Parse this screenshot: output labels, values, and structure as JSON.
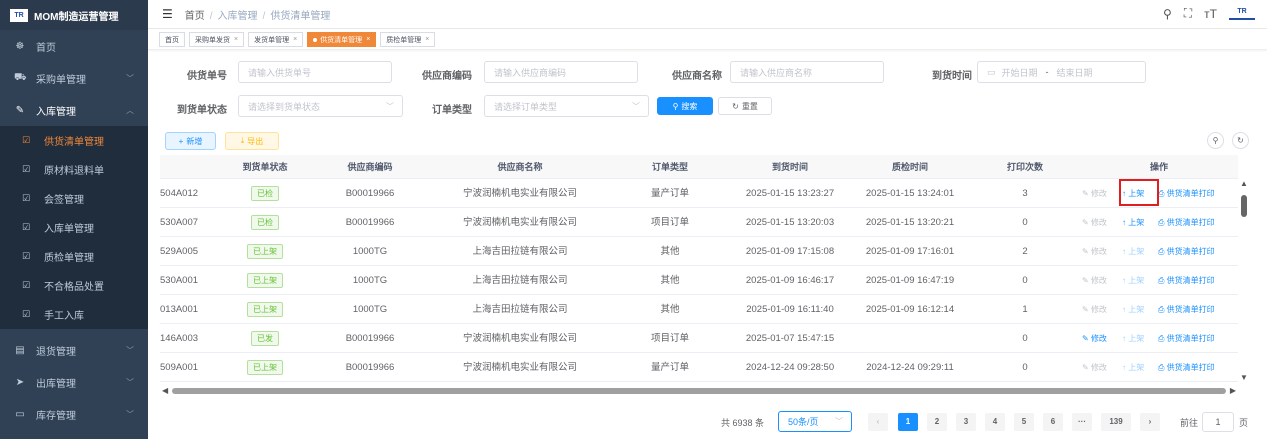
{
  "app": {
    "logo_text": "TR",
    "title": "MOM制造运营管理"
  },
  "sidebar": {
    "items": [
      {
        "label": "首页",
        "icon": "dashboard-icon",
        "glyph": "☸"
      },
      {
        "label": "采购单管理",
        "icon": "cart-icon",
        "glyph": "🛒"
      },
      {
        "label": "入库管理",
        "icon": "edit-icon",
        "glyph": "✎"
      },
      {
        "label": "退货管理",
        "icon": "return-icon",
        "glyph": "▤"
      },
      {
        "label": "出库管理",
        "icon": "send-icon",
        "glyph": "➤"
      },
      {
        "label": "库存管理",
        "icon": "monitor-icon",
        "glyph": "▭"
      }
    ],
    "sub_items": [
      "供货清单管理",
      "原材料退料单",
      "会签管理",
      "入库单管理",
      "质检单管理",
      "不合格品处置",
      "手工入库"
    ]
  },
  "header": {
    "breadcrumb": [
      "首页",
      "入库管理",
      "供货清单管理"
    ],
    "logo_text": "TR"
  },
  "tags": [
    {
      "label": "首页",
      "closable": false
    },
    {
      "label": "采购单发货",
      "closable": true
    },
    {
      "label": "发货单管理",
      "closable": true
    },
    {
      "label": "供货清单管理",
      "closable": true,
      "active": true
    },
    {
      "label": "质检单管理",
      "closable": true
    }
  ],
  "search": {
    "supply_no": {
      "label": "供货单号",
      "placeholder": "请输入供货单号"
    },
    "supplier_code": {
      "label": "供应商编码",
      "placeholder": "请输入供应商编码"
    },
    "supplier_name": {
      "label": "供应商名称",
      "placeholder": "请输入供应商名称"
    },
    "arrival_time": {
      "label": "到货时间",
      "start": "开始日期",
      "sep": "-",
      "end": "结束日期"
    },
    "arrival_status": {
      "label": "到货单状态",
      "placeholder": "请选择到货单状态"
    },
    "order_type": {
      "label": "订单类型",
      "placeholder": "请选择订单类型"
    },
    "search_btn": "搜索",
    "reset_btn": "重置"
  },
  "toolbar": {
    "add": "新增",
    "export": "导出"
  },
  "table": {
    "headers": [
      "到货单状态",
      "供应商编码",
      "供应商名称",
      "订单类型",
      "到货时间",
      "质检时间",
      "打印次数",
      "操作"
    ],
    "rows": [
      {
        "no": "504A012",
        "status": "已检",
        "code": "B00019966",
        "name": "宁波润楠机电实业有限公司",
        "type": "量产订单",
        "arrival": "2025-01-15 13:23:27",
        "qc": "2025-01-15 13:24:01",
        "prints": "3",
        "edit_on": false,
        "shelf_on": true
      },
      {
        "no": "530A007",
        "status": "已检",
        "code": "B00019966",
        "name": "宁波润楠机电实业有限公司",
        "type": "项目订单",
        "arrival": "2025-01-15 13:20:03",
        "qc": "2025-01-15 13:20:21",
        "prints": "0",
        "edit_on": false,
        "shelf_on": true
      },
      {
        "no": "529A005",
        "status": "已上架",
        "code": "1000TG",
        "name": "上海吉田拉链有限公司",
        "type": "其他",
        "arrival": "2025-01-09 17:15:08",
        "qc": "2025-01-09 17:16:01",
        "prints": "2",
        "edit_on": false,
        "shelf_on": false
      },
      {
        "no": "530A001",
        "status": "已上架",
        "code": "1000TG",
        "name": "上海吉田拉链有限公司",
        "type": "其他",
        "arrival": "2025-01-09 16:46:17",
        "qc": "2025-01-09 16:47:19",
        "prints": "0",
        "edit_on": false,
        "shelf_on": false
      },
      {
        "no": "013A001",
        "status": "已上架",
        "code": "1000TG",
        "name": "上海吉田拉链有限公司",
        "type": "其他",
        "arrival": "2025-01-09 16:11:40",
        "qc": "2025-01-09 16:12:14",
        "prints": "1",
        "edit_on": false,
        "shelf_on": false
      },
      {
        "no": "146A003",
        "status": "已发",
        "code": "B00019966",
        "name": "宁波润楠机电实业有限公司",
        "type": "项目订单",
        "arrival": "2025-01-07 15:47:15",
        "qc": "",
        "prints": "0",
        "edit_on": true,
        "shelf_on": false
      },
      {
        "no": "509A001",
        "status": "已上架",
        "code": "B00019966",
        "name": "宁波润楠机电实业有限公司",
        "type": "量产订单",
        "arrival": "2024-12-24 09:28:50",
        "qc": "2024-12-24 09:29:11",
        "prints": "0",
        "edit_on": false,
        "shelf_on": false
      }
    ],
    "actions": {
      "edit": "修改",
      "shelf": "上架",
      "print": "供货清单打印"
    }
  },
  "pagination": {
    "total": "共 6938 条",
    "page_size": "50条/页",
    "pages": [
      "1",
      "2",
      "3",
      "4",
      "5",
      "6",
      "···",
      "139"
    ],
    "goto_label": "前往",
    "goto_value": "1",
    "page_suffix": "页"
  }
}
